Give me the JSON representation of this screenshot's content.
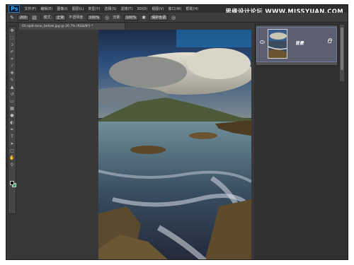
{
  "app": {
    "logo": "Ps",
    "watermark": "思缘设计论坛 WWW.MISSYUAN.COM"
  },
  "menubar": {
    "items": [
      "文件(F)",
      "编辑(E)",
      "图像(I)",
      "图层(L)",
      "类型(Y)",
      "选择(S)",
      "滤镜(T)",
      "3D(D)",
      "视图(V)",
      "窗口(W)",
      "帮助(H)"
    ]
  },
  "options": {
    "brush_size": "200",
    "mode_label": "模式:",
    "mode_value": "正常",
    "opacity_label": "不透明度:",
    "opacity_value": "100%",
    "flow_label": "流量:",
    "flow_value": "100%",
    "protect_tones_label": "保护色调"
  },
  "document": {
    "tab_title": "01-split-tone_before.jpg @ 20.7% (RGB/8*) *"
  },
  "layers": {
    "layer_name": "背景"
  },
  "colors": {
    "foreground": "#000000",
    "background": "#1fa85a",
    "selection": "#5c5f70"
  },
  "tools": [
    "move",
    "marquee",
    "lasso",
    "quick-select",
    "crop",
    "eyedropper",
    "healing",
    "brush",
    "clone-stamp",
    "history-brush",
    "eraser",
    "gradient",
    "blur",
    "dodge",
    "pen",
    "type",
    "path-select",
    "shape",
    "hand",
    "zoom"
  ]
}
